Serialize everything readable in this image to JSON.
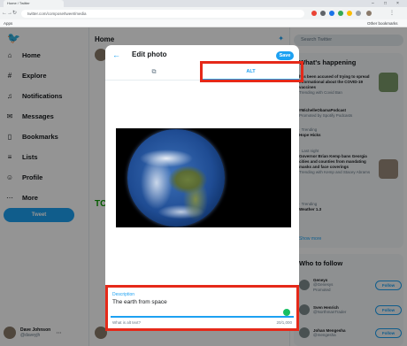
{
  "browser": {
    "tab_title": "Home / Twitter",
    "url": "twitter.com/compose/tweet/media",
    "bookmarks_left": "Apps",
    "bookmarks_right": "Other bookmarks",
    "back_glyph": "←",
    "forward_glyph": "→",
    "reload_glyph": "↻",
    "home_glyph": "⌂",
    "minimize_glyph": "–",
    "maximize_glyph": "□",
    "close_glyph": "×"
  },
  "sidebar": {
    "items": [
      {
        "label": "Home",
        "icon": "home-icon",
        "glyph": "⌂"
      },
      {
        "label": "Explore",
        "icon": "hashtag-icon",
        "glyph": "#"
      },
      {
        "label": "Notifications",
        "icon": "bell-icon",
        "glyph": "♫"
      },
      {
        "label": "Messages",
        "icon": "envelope-icon",
        "glyph": "✉"
      },
      {
        "label": "Bookmarks",
        "icon": "bookmark-icon",
        "glyph": "▯"
      },
      {
        "label": "Lists",
        "icon": "list-icon",
        "glyph": "≡"
      },
      {
        "label": "Profile",
        "icon": "person-icon",
        "glyph": "☺"
      },
      {
        "label": "More",
        "icon": "more-icon",
        "glyph": "⋯"
      }
    ],
    "tweet_button": "Tweet",
    "user_name": "Dave Johnson",
    "user_handle": "@daveyjh"
  },
  "main": {
    "title": "Home"
  },
  "right": {
    "search_placeholder": "Search Twitter",
    "trends_title": "What's happening",
    "trends": [
      {
        "meta": "",
        "text": "has been accused of trying to spread informational about the COVID-19 vaccines",
        "extra": "Trending with Covid Ban"
      },
      {
        "meta": "#MichelleObamaPodcast",
        "text": "",
        "extra": "Promoted by Spotify Podcasts"
      },
      {
        "meta": "· Trending",
        "text": "Hope Hicks",
        "extra": ""
      },
      {
        "meta": "· Last night",
        "text": "Governor Brian Kemp bans Georgia cities and counties from mandating masks and face coverings",
        "extra": "Trending with Kemp and Stacey Abrams"
      },
      {
        "meta": "· Trending",
        "text": "Weather 1.3",
        "extra": ""
      }
    ],
    "show_more": "Show more",
    "who_to_follow_title": "Who to follow",
    "follows": [
      {
        "name": "Geneys",
        "handle": "@Genesys",
        "sub": "Promoted",
        "button": "Follow"
      },
      {
        "name": "Sven Henrich",
        "handle": "@NorthmanTrader",
        "sub": "",
        "button": "Follow"
      },
      {
        "name": "Johan Mengesha",
        "handle": "@mengesha",
        "sub": "",
        "button": "Follow"
      }
    ]
  },
  "modal": {
    "title": "Edit photo",
    "save_label": "Save",
    "tab_crop_glyph": "⧉",
    "tab_alt_label": "ALT",
    "description_label": "Description",
    "description_value": "The earth from space",
    "help_link": "What is alt text?",
    "char_count": "20/1,000",
    "back_glyph": "←"
  },
  "colors": {
    "accent": "#1da1f2",
    "highlight": "#e52919"
  }
}
